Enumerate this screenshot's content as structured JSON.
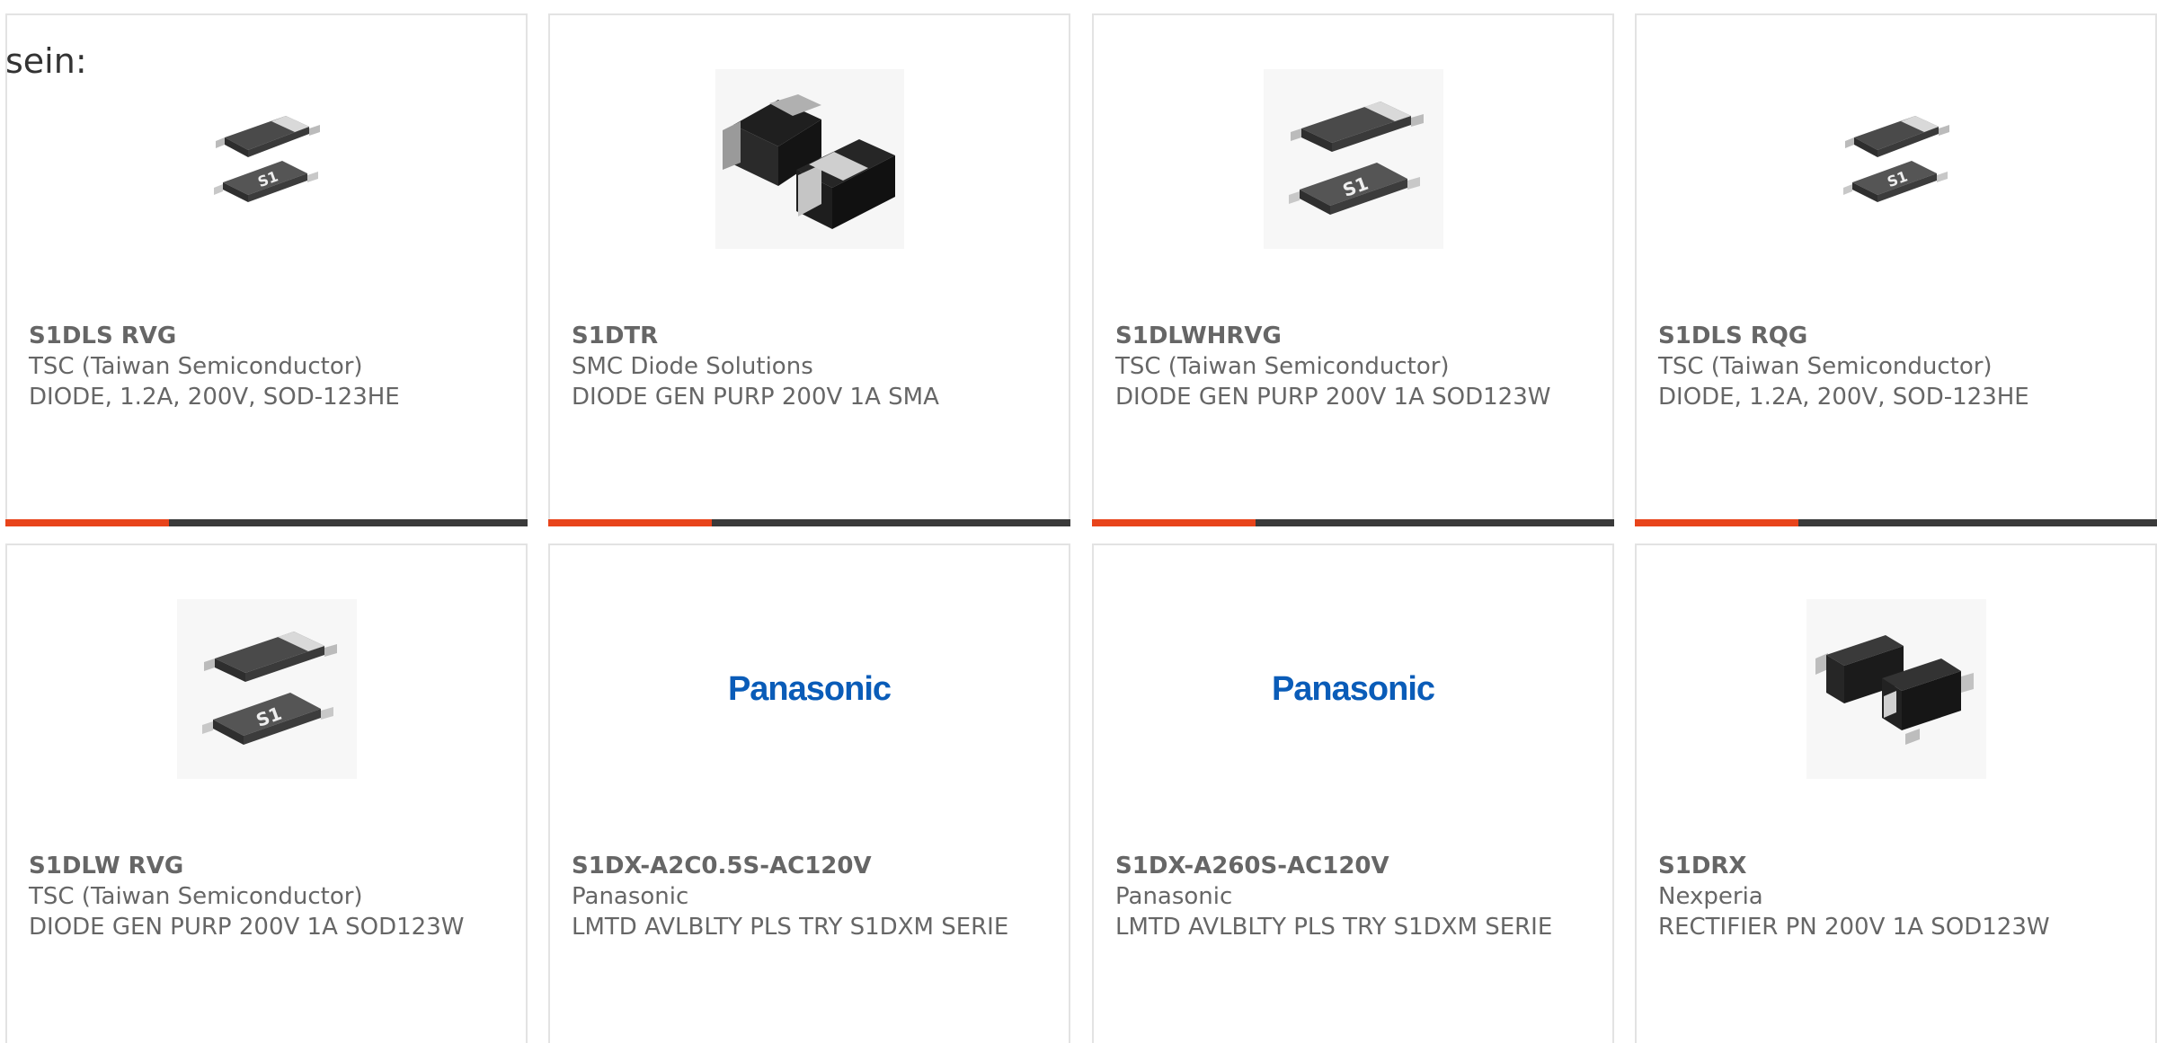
{
  "intro_text": "sein:",
  "colors": {
    "accent": "#e8441b",
    "bar": "#3a3a3a",
    "panasonic_blue": "#0a5cb8"
  },
  "products": [
    {
      "part_number": "S1DLS RVG",
      "manufacturer": "TSC (Taiwan Semiconductor)",
      "description": "DIODE, 1.2A, 200V, SOD-123HE",
      "image": "sod123-diode-icon"
    },
    {
      "part_number": "S1DTR",
      "manufacturer": "SMC Diode Solutions",
      "description": "DIODE GEN PURP 200V 1A SMA",
      "image": "sma-diode-icon"
    },
    {
      "part_number": "S1DLWHRVG",
      "manufacturer": "TSC (Taiwan Semiconductor)",
      "description": "DIODE GEN PURP 200V 1A SOD123W",
      "image": "sod123-diode-icon"
    },
    {
      "part_number": "S1DLS RQG",
      "manufacturer": "TSC (Taiwan Semiconductor)",
      "description": "DIODE, 1.2A, 200V, SOD-123HE",
      "image": "sod123-diode-icon"
    },
    {
      "part_number": "S1DLW RVG",
      "manufacturer": "TSC (Taiwan Semiconductor)",
      "description": "DIODE GEN PURP 200V 1A SOD123W",
      "image": "sod123-diode-icon"
    },
    {
      "part_number": "S1DX-A2C0.5S-AC120V",
      "manufacturer": "Panasonic",
      "description": "LMTD AVLBLTY PLS TRY S1DXM SERIE",
      "image": "panasonic-logo",
      "logo_text": "Panasonic"
    },
    {
      "part_number": "S1DX-A260S-AC120V",
      "manufacturer": "Panasonic",
      "description": "LMTD AVLBLTY PLS TRY S1DXM SERIE",
      "image": "panasonic-logo",
      "logo_text": "Panasonic"
    },
    {
      "part_number": "S1DRX",
      "manufacturer": "Nexperia",
      "description": "RECTIFIER PN 200V 1A SOD123W",
      "image": "sod123w-diode-icon"
    }
  ]
}
